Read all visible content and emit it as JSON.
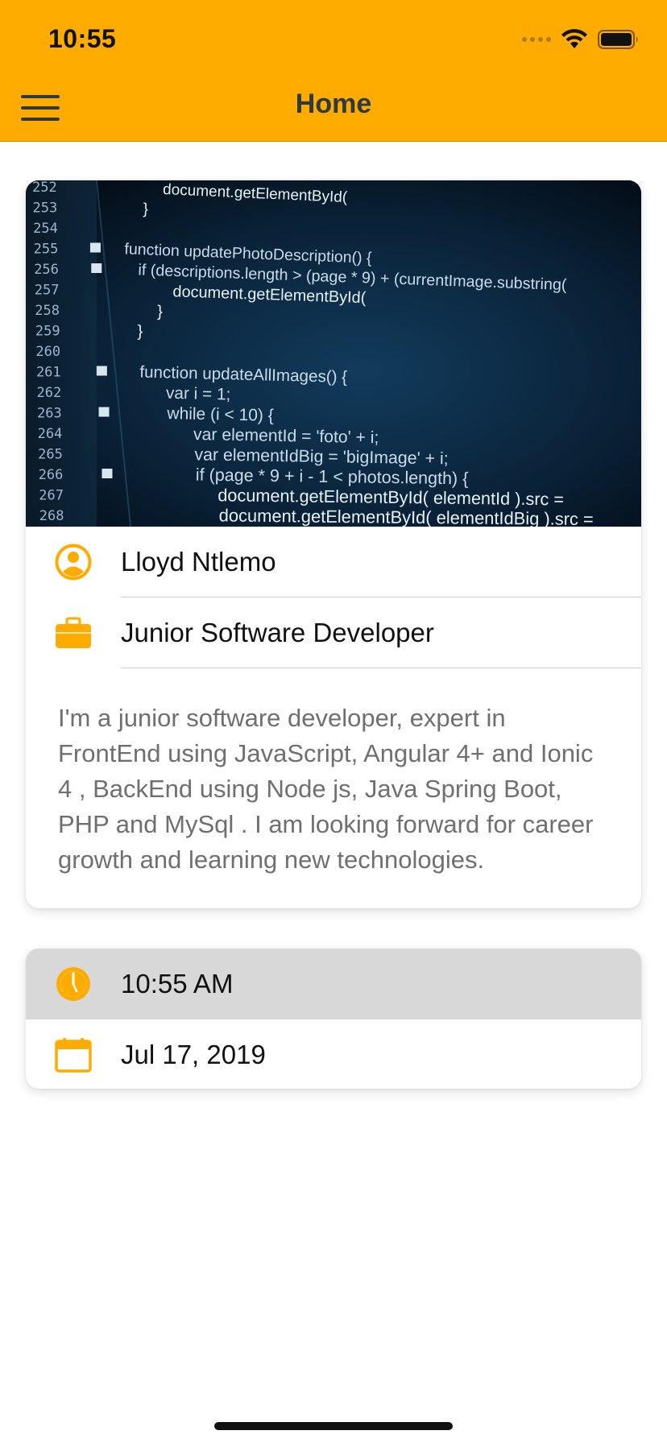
{
  "status_bar": {
    "time": "10:55"
  },
  "header": {
    "title": "Home",
    "menu_icon": "hamburger-menu-icon"
  },
  "profile_card": {
    "hero_image": "code-editor-screenshot",
    "code_lines": [
      {
        "num": "252",
        "text": "document.getElementById("
      },
      {
        "num": "253",
        "text": "}"
      },
      {
        "num": "254",
        "text": ""
      },
      {
        "num": "255",
        "text": "function updatePhotoDescription() {"
      },
      {
        "num": "256",
        "text": "if (descriptions.length > (page * 9) + (currentImage.substring("
      },
      {
        "num": "257",
        "text": "document.getElementById("
      },
      {
        "num": "258",
        "text": "}"
      },
      {
        "num": "259",
        "text": "}"
      },
      {
        "num": "260",
        "text": ""
      },
      {
        "num": "261",
        "text": "function updateAllImages() {"
      },
      {
        "num": "262",
        "text": "var i = 1;"
      },
      {
        "num": "263",
        "text": "while (i < 10) {"
      },
      {
        "num": "264",
        "text": "var elementId = 'foto' + i;"
      },
      {
        "num": "265",
        "text": "var elementIdBig = 'bigImage' + i;"
      },
      {
        "num": "266",
        "text": "if (page * 9 + i - 1 < photos.length) {"
      },
      {
        "num": "267",
        "text": "document.getElementById( elementId ).src ="
      },
      {
        "num": "268",
        "text": "document.getElementById( elementIdBig ).src ="
      }
    ],
    "name": "Lloyd Ntlemo",
    "name_icon": "person-circle-icon",
    "job_title": "Junior Software Developer",
    "job_icon": "briefcase-icon",
    "bio": "I'm a junior software developer, expert in FrontEnd using JavaScript, Angular 4+ and Ionic 4 , BackEnd using Node js, Java Spring Boot, PHP and MySql . I am looking forward for career growth and learning new technologies."
  },
  "datetime_card": {
    "time": "10:55 AM",
    "time_icon": "clock-icon",
    "date": "Jul 17, 2019",
    "date_icon": "calendar-icon"
  },
  "colors": {
    "accent": "#ffab00",
    "header_text": "#2f3a3e",
    "bio_text": "#6f6f6f",
    "highlight_row": "#d8d8d8"
  }
}
